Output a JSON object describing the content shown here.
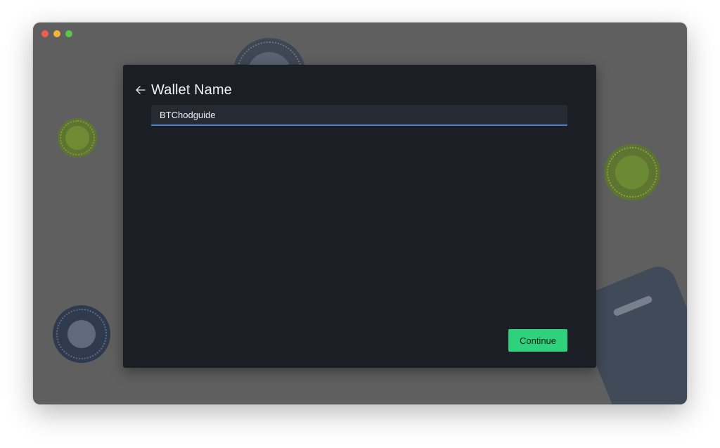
{
  "window": {
    "controls": [
      "close",
      "minimize",
      "maximize"
    ]
  },
  "dialog": {
    "title": "Wallet Name",
    "back_icon": "arrow-left-icon",
    "name_input": {
      "value": "BTChodguide",
      "placeholder": ""
    },
    "continue_label": "Continue"
  },
  "colors": {
    "accent": "#2fd27c",
    "focus": "#4d7fd1",
    "dialog_bg": "#1b1e25",
    "backdrop": "#5f5f5f"
  }
}
